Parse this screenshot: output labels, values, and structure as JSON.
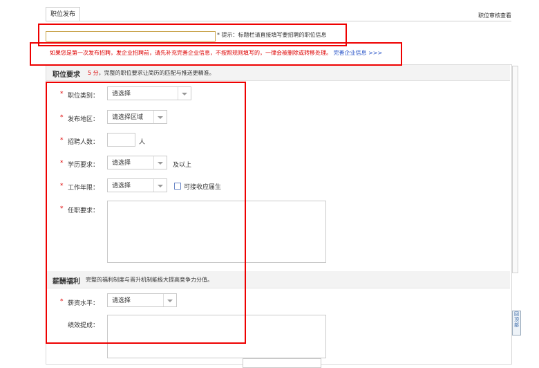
{
  "tab": {
    "label": "职位发布"
  },
  "top_right_link": "职位审核查看",
  "title_input": {
    "value": "",
    "placeholder": ""
  },
  "hint": "* 提示：标题栏请直接填写要招聘的职位信息",
  "warning": {
    "text": "如果您是第一次发布招聘，发企业招聘前，请先补充完善企业信息，不按照规则填写的，一律会被删除或转移处理。",
    "link": "完善企业信息 >>>"
  },
  "section_job": {
    "title": "职位要求",
    "score": "5 分",
    "desc": "，完整的职位要求让简历的匹配与推送更精准。"
  },
  "fields": {
    "category": {
      "label": "职位类别：",
      "value": "请选择"
    },
    "region": {
      "label": "发布地区：",
      "value": "请选择区域"
    },
    "headcount": {
      "label": "招聘人数：",
      "value": "",
      "unit": "人"
    },
    "education": {
      "label": "学历要求：",
      "value": "请选择",
      "suffix": "及以上"
    },
    "experience": {
      "label": "工作年限：",
      "value": "请选择",
      "checkbox_label": "可接收应届生"
    },
    "requirements": {
      "label": "任职要求：",
      "value": ""
    }
  },
  "section_salary": {
    "title": "薪酬福利",
    "desc": "完整的福利制度与晋升机制能极大提高竞争力分值。"
  },
  "salary_fields": {
    "salary": {
      "label": "薪资水平：",
      "value": "请选择"
    },
    "bonus": {
      "label": "绩效提成：",
      "value": ""
    }
  },
  "back_to_top": "回顶部",
  "required_mark": "*",
  "colors": {
    "accent_red": "#dd0000",
    "link_blue": "#2a55c8",
    "annotation_red": "#ee0000"
  }
}
